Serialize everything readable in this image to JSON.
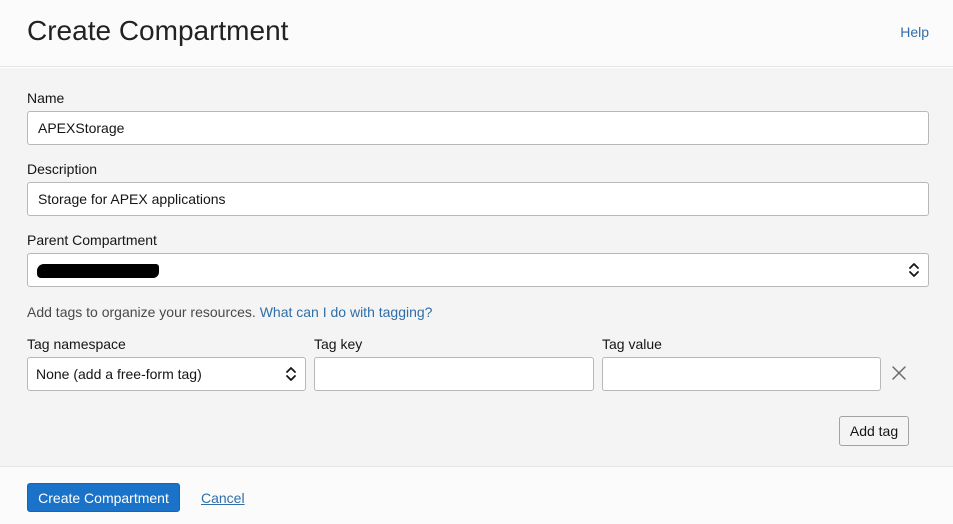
{
  "header": {
    "title": "Create Compartment",
    "help_label": "Help"
  },
  "form": {
    "name": {
      "label": "Name",
      "value": "APEXStorage"
    },
    "description": {
      "label": "Description",
      "value": "Storage for APEX applications"
    },
    "parent": {
      "label": "Parent Compartment"
    },
    "tags_hint": {
      "text": "Add tags to organize your resources.",
      "link": "What can I do with tagging?"
    },
    "tag_namespace": {
      "label": "Tag namespace",
      "selected": "None (add a free-form tag)"
    },
    "tag_key": {
      "label": "Tag key",
      "value": ""
    },
    "tag_value": {
      "label": "Tag value",
      "value": ""
    },
    "add_tag_label": "Add tag"
  },
  "footer": {
    "create_label": "Create Compartment",
    "cancel_label": "Cancel"
  },
  "colors": {
    "primary": "#1a73c9",
    "link": "#2f6ea8"
  }
}
